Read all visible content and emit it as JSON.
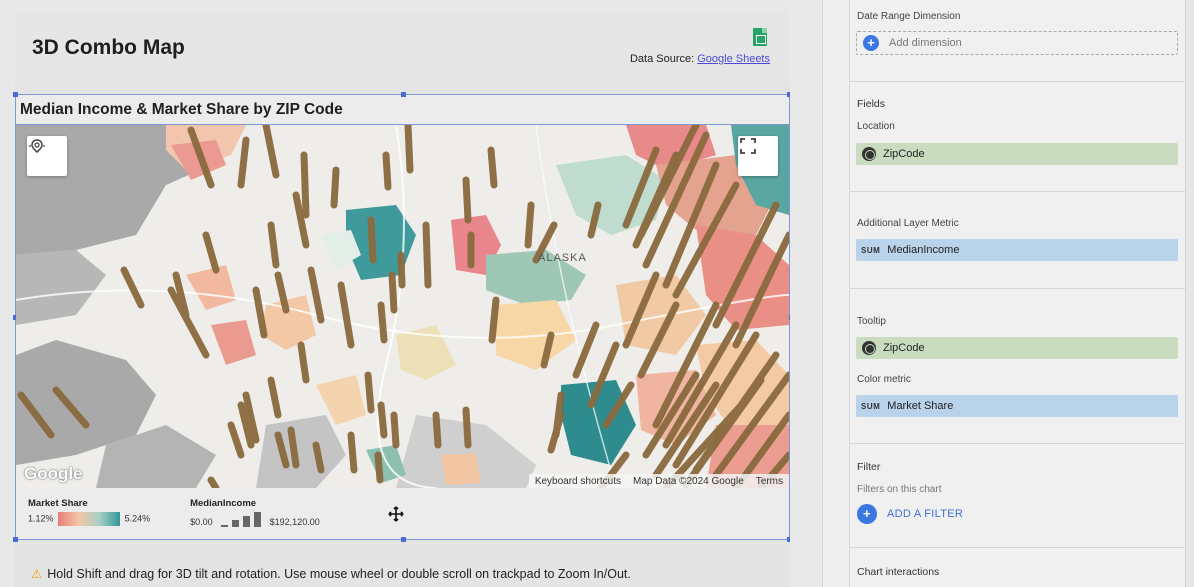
{
  "report": {
    "title": "3D Combo Map",
    "data_source_label": "Data Source:",
    "data_source_link": "Google Sheets"
  },
  "chart": {
    "title": "Median Income & Market Share by ZIP Code",
    "map_label": "ALASKA",
    "google_logo": "Google",
    "attribution": [
      "Keyboard shortcuts",
      "Map Data ©2024 Google",
      "Terms"
    ],
    "legend": {
      "market_share_title": "Market Share",
      "market_share_min": "1.12%",
      "market_share_max": "5.24%",
      "median_income_title": "MedianIncome",
      "median_income_min": "$0.00",
      "median_income_max": "$192,120.00"
    }
  },
  "hint": "Hold Shift and drag for 3D tilt and rotation. Use mouse wheel or double scroll on trackpad to Zoom In/Out.",
  "panel": {
    "date_range_dimension": "Date Range Dimension",
    "add_dimension": "Add dimension",
    "fields": "Fields",
    "location": "Location",
    "location_field": "ZipCode",
    "additional_layer_metric": "Additional Layer Metric",
    "additional_metric_agg": "SUM",
    "additional_metric_field": "MedianIncome",
    "tooltip": "Tooltip",
    "tooltip_field": "ZipCode",
    "color_metric": "Color metric",
    "color_metric_agg": "SUM",
    "color_metric_field": "Market Share",
    "filter": "Filter",
    "filters_on_chart": "Filters on this chart",
    "add_filter": "ADD A FILTER",
    "chart_interactions": "Chart interactions"
  },
  "colors": {
    "accent": "#3b77e0",
    "dimension_chip": "#c9dcbf",
    "metric_chip": "#b9d3ea",
    "selection": "#4a6bcf"
  }
}
